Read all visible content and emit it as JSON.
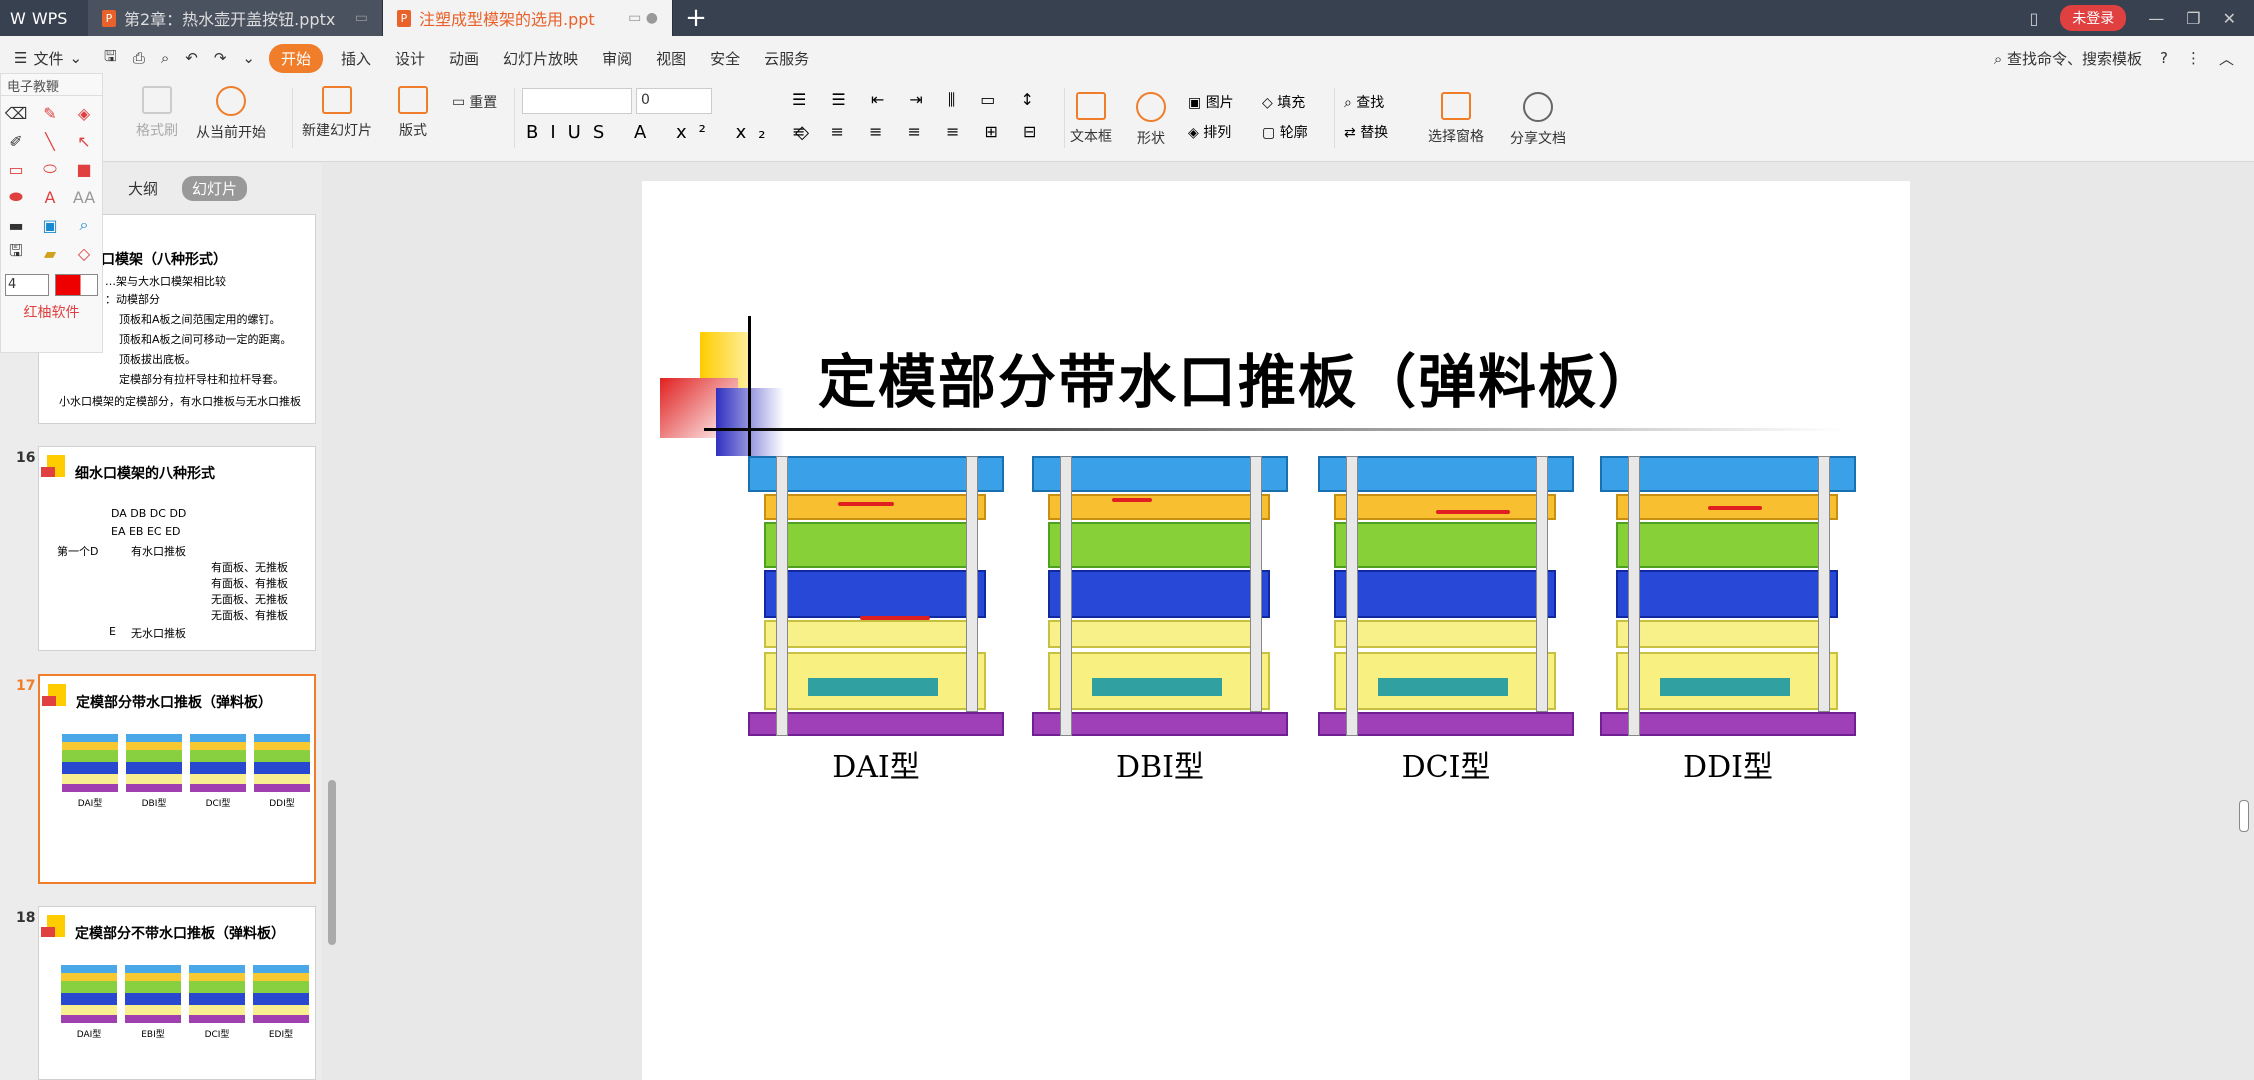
{
  "titlebar": {
    "app": "WPS",
    "tabs": [
      {
        "label": "第2章：热水壶开盖按钮.pptx",
        "active": false
      },
      {
        "label": "注塑成型模架的选用.ppt",
        "active": true
      }
    ],
    "login": "未登录"
  },
  "menu": {
    "file": "文件",
    "items": [
      "开始",
      "插入",
      "设计",
      "动画",
      "幻灯片放映",
      "审阅",
      "视图",
      "安全",
      "云服务"
    ],
    "search": "查找命令、搜索模板"
  },
  "ribbon": {
    "play_from_current": "从当前开始",
    "new_slide": "新建幻灯片",
    "layout": "版式",
    "reset": "重置",
    "font_size": "0",
    "textbox": "文本框",
    "shape": "形状",
    "picture": "图片",
    "fill": "填充",
    "arrange": "排列",
    "outline": "轮廓",
    "find": "查找",
    "replace": "替换",
    "select_pane": "选择窗格",
    "share": "分享文档",
    "format_painter": "格式刷"
  },
  "tool_panel": {
    "title": "电子教鞭",
    "size": "4",
    "footer": "红柚软件"
  },
  "pane": {
    "tabs": [
      "大纲",
      "幻灯片"
    ]
  },
  "thumbs": [
    {
      "num": "",
      "title": "口模架（八种形式）"
    },
    {
      "num": "16",
      "title": "细水口模架的八种形式"
    },
    {
      "num": "17",
      "title": "定模部分带水口推板（弹料板）",
      "labels": [
        "DAI型",
        "DBI型",
        "DCI型",
        "DDI型"
      ]
    },
    {
      "num": "18",
      "title": "定模部分不带水口推板（弹料板）",
      "labels": [
        "DAI型",
        "EBI型",
        "DCI型",
        "EDI型"
      ]
    }
  ],
  "thumb15_lines": [
    "…架与大水口模架相比较",
    "：动模部分",
    "顶板和A板之间范围定用的螺钉。",
    "顶板和A板之间可移动一定的距离。",
    "顶板拔出底板。",
    "定模部分有拉杆导柱和拉杆导套。",
    "小水口模架的定模部分，有水口推板与无水口推板"
  ],
  "thumb16_lines": [
    "DA  DB  DC  DD",
    "EA  EB  EC  ED",
    "第一个D",
    "有水口推板",
    "无水口推板",
    "E",
    "有面板、无推板",
    "有面板、有推板",
    "无面板、无推板",
    "无面板、有推板"
  ],
  "slide": {
    "title": "定模部分带水口推板（弹料板）",
    "molds": [
      {
        "label": "DAI型"
      },
      {
        "label": "DBI型"
      },
      {
        "label": "DCI型"
      },
      {
        "label": "DDI型"
      }
    ]
  },
  "colors": {
    "accent": "#f07d2a",
    "titlebar": "#384150"
  }
}
